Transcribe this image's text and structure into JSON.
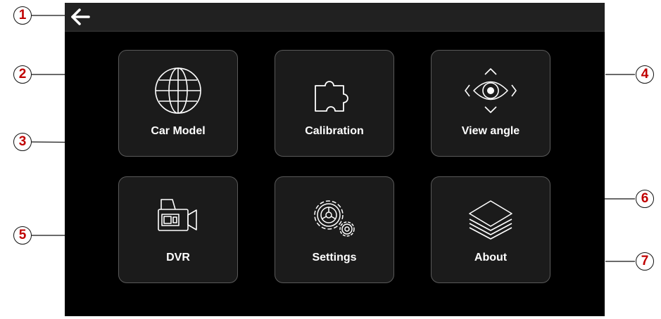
{
  "menu": {
    "car_model": "Car Model",
    "calibration": "Calibration",
    "view_angle": "View angle",
    "dvr": "DVR",
    "settings": "Settings",
    "about": "About"
  },
  "callouts": [
    "1",
    "2",
    "3",
    "4",
    "5",
    "6",
    "7"
  ],
  "colors": {
    "screen_bg": "#000000",
    "topbar_bg": "#212121",
    "tile_bg": "#1b1b1b",
    "tile_border": "#5a5a5a",
    "callout_number": "#c00000"
  }
}
